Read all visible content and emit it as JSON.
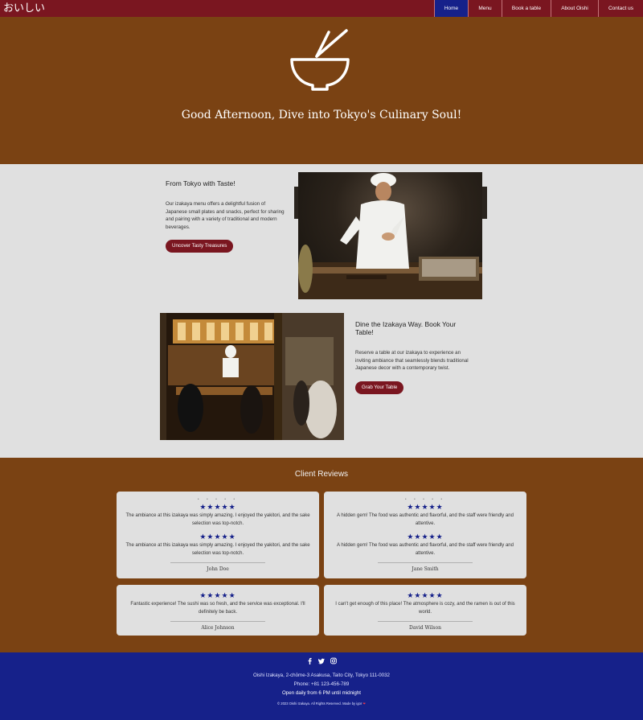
{
  "nav": {
    "brand": "おいしい",
    "items": [
      {
        "label": "Home",
        "active": true
      },
      {
        "label": "Menu",
        "active": false
      },
      {
        "label": "Book a table",
        "active": false
      },
      {
        "label": "About Oishi",
        "active": false
      },
      {
        "label": "Contact us",
        "active": false
      }
    ]
  },
  "hero": {
    "icon": "bowl-with-chopsticks-icon",
    "title": "Good Afternoon, Dive into Tokyo's Culinary Soul!"
  },
  "features": [
    {
      "title": "From Tokyo with Taste!",
      "description": "Our izakaya menu offers a delightful fusion of Japanese small plates and snacks, perfect for sharing and pairing with a variety of traditional and modern beverages.",
      "button": "Uncover Tasty Treasures",
      "image": "chef-preparing-food-photo"
    },
    {
      "title": "Dine the Izakaya Way. Book Your Table!",
      "description": "Reserve a table at our izakaya to experience an inviting ambiance that seamlessly blends traditional Japanese decor with a contemporary twist.",
      "button": "Grab Your Table",
      "image": "izakaya-interior-photo"
    }
  ],
  "reviews": {
    "title": "Client Reviews",
    "stars": "★★★★★",
    "dots": "• • • • •",
    "cards": [
      {
        "texts": [
          "The ambiance at this izakaya was simply amazing. I enjoyed the yakitori, and the sake selection was top-notch.",
          "The ambiance at this izakaya was simply amazing. I enjoyed the yakitori, and the sake selection was top-notch."
        ],
        "name": "John Doe"
      },
      {
        "texts": [
          "A hidden gem! The food was authentic and flavorful, and the staff were friendly and attentive.",
          "A hidden gem! The food was authentic and flavorful, and the staff were friendly and attentive."
        ],
        "name": "Jane Smith"
      },
      {
        "texts": [
          "Fantastic experience! The sushi was so fresh, and the service was exceptional. I'll definitely be back."
        ],
        "name": "Alice Johnson"
      },
      {
        "texts": [
          "I can't get enough of this place! The atmosphere is cozy, and the ramen is out of this world."
        ],
        "name": "David Wilson"
      }
    ]
  },
  "footer": {
    "socials": [
      "facebook-icon",
      "twitter-icon",
      "instagram-icon"
    ],
    "address": "Oishi Izakaya, 2-chōme-3 Asakusa, Taito City, Tokyo 111-0032",
    "phone": "Phone: +81 123-456-789",
    "hours": "Open daily from 6 PM until midnight",
    "copyright": "© 2023 Oishi Izakaya. All Rights Reserved. Made by igor",
    "heart": "❤"
  },
  "colors": {
    "nav_bg": "#7a1620",
    "nav_active": "#16218a",
    "hero_bg": "#7a4213",
    "section_bg": "#e0e0e0",
    "footer_bg": "#16218a",
    "button_bg": "#7a1620",
    "star": "#16218a"
  }
}
